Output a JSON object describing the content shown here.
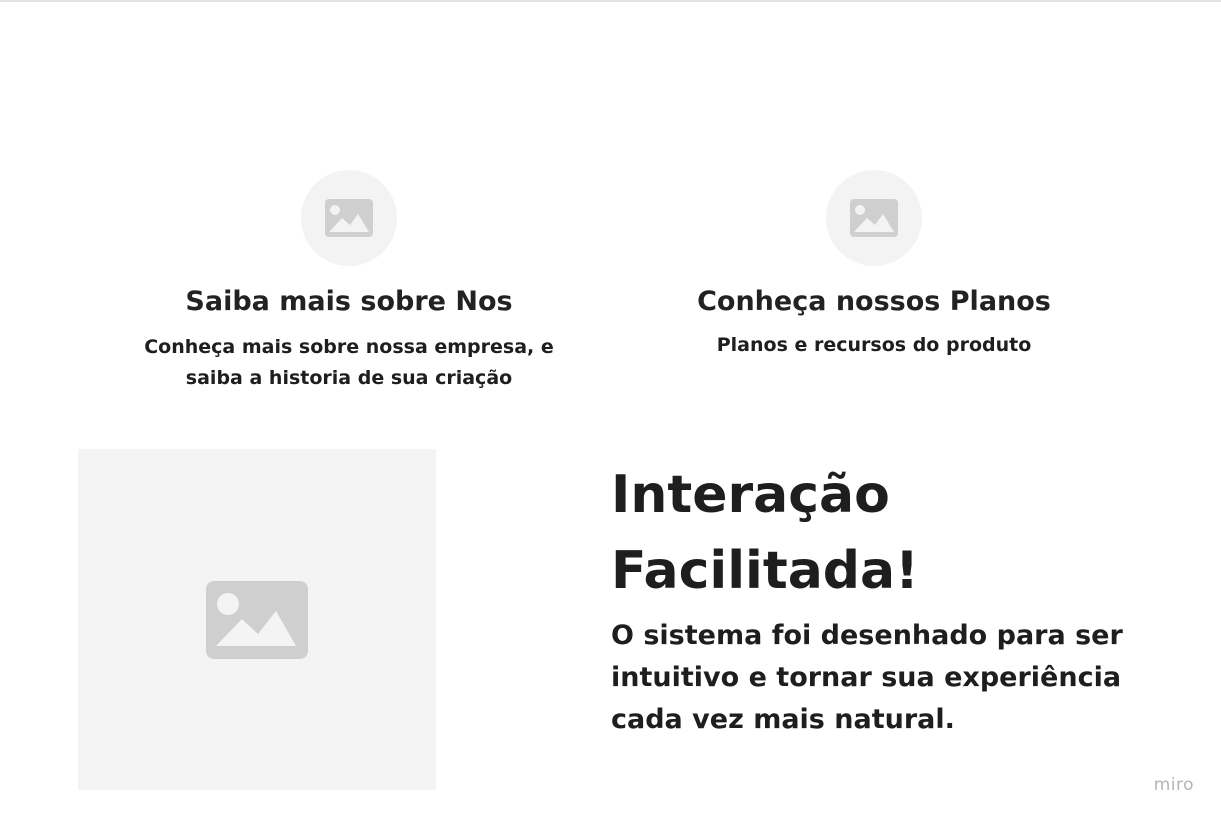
{
  "features": [
    {
      "icon": "image-placeholder-icon",
      "title": "Saiba mais sobre Nos",
      "description": "Conheça mais sobre nossa empresa, e saiba a historia de sua criação"
    },
    {
      "icon": "image-placeholder-icon",
      "title": "Conheça nossos Planos",
      "description": "Planos e recursos do produto"
    }
  ],
  "hero": {
    "image_icon": "image-placeholder-icon",
    "title_line1": "Interação",
    "title_line2": "Facilitada!",
    "body": "O sistema foi desenhado para ser intuitivo e tornar sua experiência cada vez mais natural."
  },
  "watermark": "miro",
  "colors": {
    "placeholder_bg": "#f3f3f3",
    "placeholder_icon": "#cfcfcf",
    "text": "#1e1e1e",
    "watermark": "#b4b4b4"
  }
}
